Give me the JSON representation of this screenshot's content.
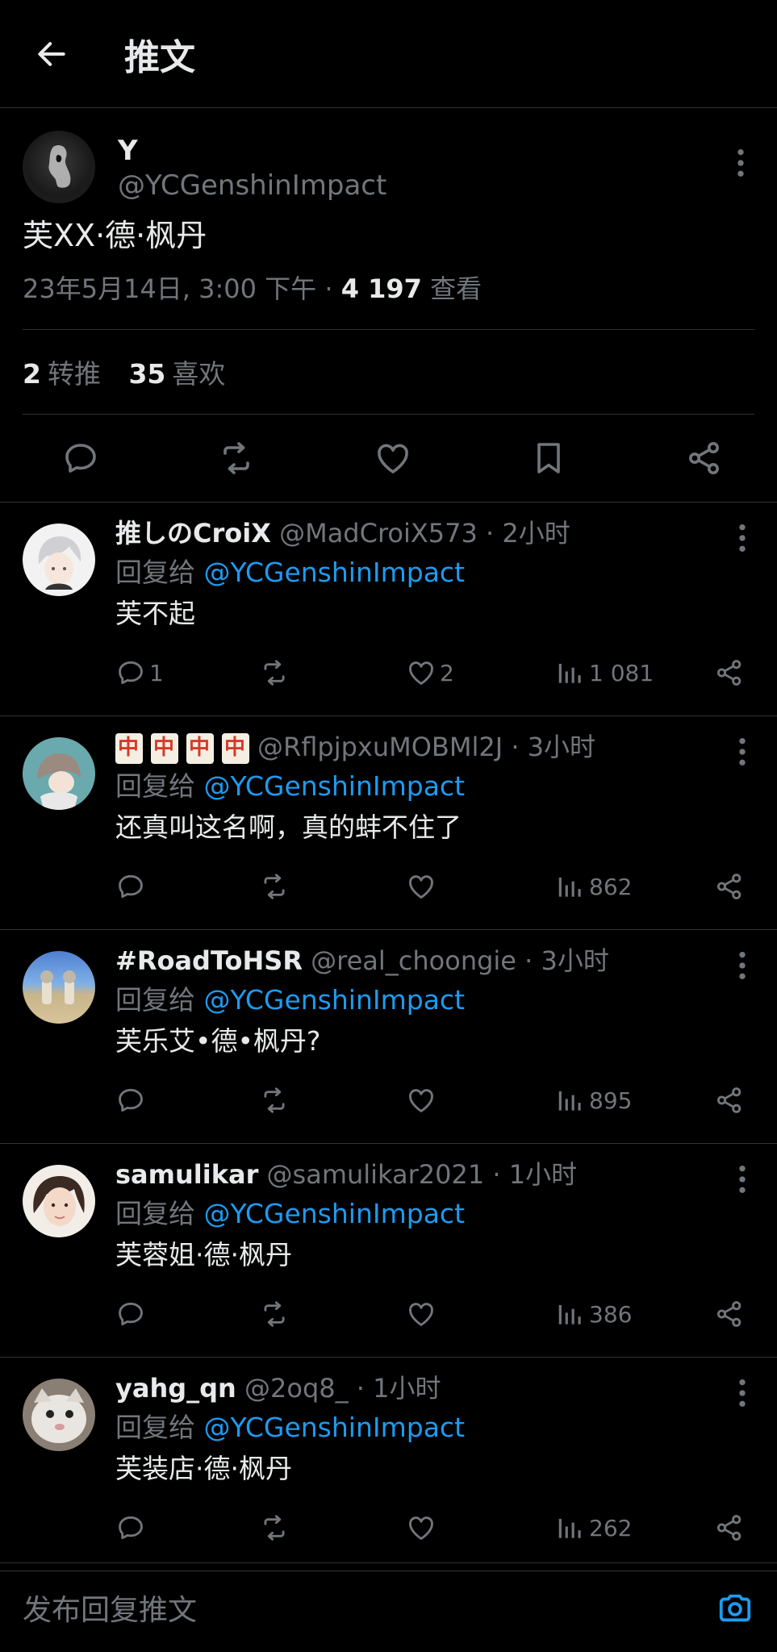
{
  "header": {
    "title": "推文"
  },
  "main_tweet": {
    "name": "Y",
    "handle": "@YCGenshinImpact",
    "text": "芙XX·德·枫丹",
    "date": "23年5月14日, 3:00 下午 · ",
    "views_count": "4 197",
    "views_label": " 查看",
    "retweets_count": "2",
    "retweets_label": "转推",
    "likes_count": "35",
    "likes_label": "喜欢"
  },
  "reply_prefix": "回复给 ",
  "reply_to": "@YCGenshinImpact",
  "replies": [
    {
      "name": "推しのCroiX",
      "handle": "@MadCroiX573 · 2小时",
      "text": "芙不起",
      "replies": "1",
      "retweets": "",
      "likes": "2",
      "views": "1 081"
    },
    {
      "name": "",
      "handle": "@RflpjpxuMOBMl2J · 3小时",
      "text": "还真叫这名啊，真的蚌不住了",
      "replies": "",
      "retweets": "",
      "likes": "",
      "views": "862"
    },
    {
      "name": "#RoadToHSR",
      "handle": "@real_choongie · 3小时",
      "text": "芙乐艾•德•枫丹?",
      "replies": "",
      "retweets": "",
      "likes": "",
      "views": "895"
    },
    {
      "name": "samulikar",
      "handle": "@samulikar2021 · 1小时",
      "text": "芙蓉姐·德·枫丹",
      "replies": "",
      "retweets": "",
      "likes": "",
      "views": "386"
    },
    {
      "name": "yahg_qn",
      "handle": "@2oq8_ · 1小时",
      "text": "芙装店·德·枫丹",
      "replies": "",
      "retweets": "",
      "likes": "",
      "views": "262"
    }
  ],
  "compose": {
    "placeholder": "发布回复推文"
  },
  "colors": {
    "accent": "#1d9bf0",
    "muted": "#71767b",
    "text": "#e7e9ea",
    "background": "#000000"
  }
}
